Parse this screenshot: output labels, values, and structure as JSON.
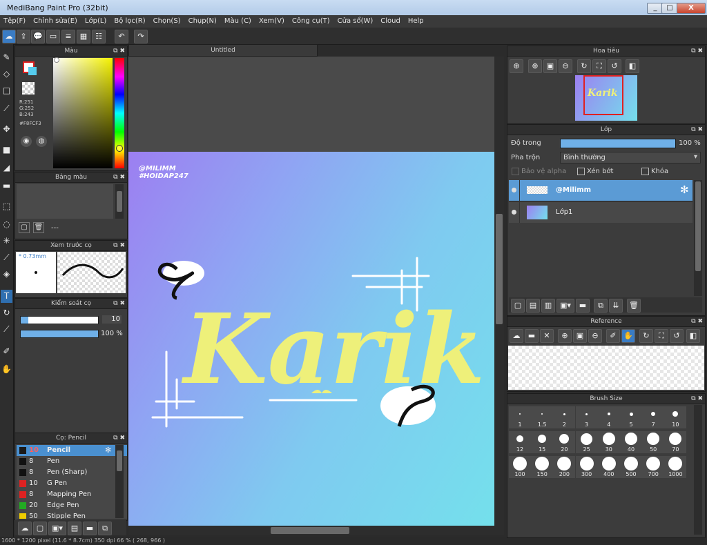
{
  "window": {
    "title": "MediBang Paint Pro (32bit)",
    "minimize": "_",
    "maximize": "□",
    "close": "X"
  },
  "menu": [
    "Tệp(F)",
    "Chỉnh sửa(E)",
    "Lớp(L)",
    "Bộ lọc(R)",
    "Chọn(S)",
    "Chụp(N)",
    "Màu (C)",
    "Xem(V)",
    "Công cụ(T)",
    "Cửa sổ(W)",
    "Cloud",
    "Help"
  ],
  "toolbar_icons": [
    "cloud-icon",
    "export-icon",
    "comment-icon",
    "message-icon",
    "document-icon",
    "grid-icon",
    "list-icon",
    "undo-icon",
    "redo-icon"
  ],
  "color_panel": {
    "title": "Màu",
    "r": "R:251",
    "g": "G:252",
    "b": "B:243",
    "hex": "#F8FCF3",
    "primary": "#ffffff",
    "secondary": "#55ccee"
  },
  "palette_panel": {
    "title": "Bảng màu",
    "dash": "---"
  },
  "preview_panel": {
    "title": "Xem trước cọ",
    "size": "* 0.73mm"
  },
  "control_panel": {
    "title": "Kiểm soát cọ",
    "size_value": "10",
    "opacity_value": "100 %",
    "size_fraction": 0.1,
    "opacity_fraction": 1.0
  },
  "brush_panel": {
    "title": "Cọ: Pencil",
    "items": [
      {
        "color": "#ff6666",
        "size": "10",
        "name": "Pencil",
        "selected": true
      },
      {
        "color": "#111111",
        "size": "8",
        "name": "Pen"
      },
      {
        "color": "#111111",
        "size": "8",
        "name": "Pen (Sharp)"
      },
      {
        "color": "#dd2222",
        "size": "10",
        "name": "G Pen"
      },
      {
        "color": "#dd2222",
        "size": "8",
        "name": "Mapping Pen"
      },
      {
        "color": "#22aa22",
        "size": "20",
        "name": "Edge Pen"
      },
      {
        "color": "#eecc00",
        "size": "50",
        "name": "Stipple Pen"
      }
    ]
  },
  "document": {
    "tab": "Untitled",
    "watermark_1": "@MILIMM",
    "watermark_2": "#HOIDAP247",
    "art_text": "Karik"
  },
  "status_bar": "1600 * 1200 pixel  (11.6 * 8.7cm)  350 dpi  66 %  ( 268, 966 )",
  "navigator_panel": {
    "title": "Hoa tiêu"
  },
  "layer_panel": {
    "title": "Lớp",
    "opacity_label": "Độ trong",
    "opacity_value": "100 %",
    "opacity_fraction": 1.0,
    "blend_label": "Pha trộn",
    "blend_value": "Bình thường",
    "protect_alpha": "Bảo vệ alpha",
    "clipping": "Xén bớt",
    "lock": "Khóa",
    "layers": [
      {
        "name": "@Milimm",
        "selected": true
      },
      {
        "name": "Lớp1",
        "selected": false
      }
    ]
  },
  "reference_panel": {
    "title": "Reference"
  },
  "brush_size_panel": {
    "title": "Brush Size",
    "sizes": [
      "1",
      "1.5",
      "2",
      "3",
      "4",
      "5",
      "7",
      "10",
      "12",
      "15",
      "20",
      "25",
      "30",
      "40",
      "50",
      "70",
      "100",
      "150",
      "200",
      "300",
      "400",
      "500",
      "700",
      "1000"
    ]
  },
  "colors": {
    "accent": "#4a90d0",
    "selected_layer": "#5b9bd5",
    "art_yellow": "#eef07a"
  }
}
